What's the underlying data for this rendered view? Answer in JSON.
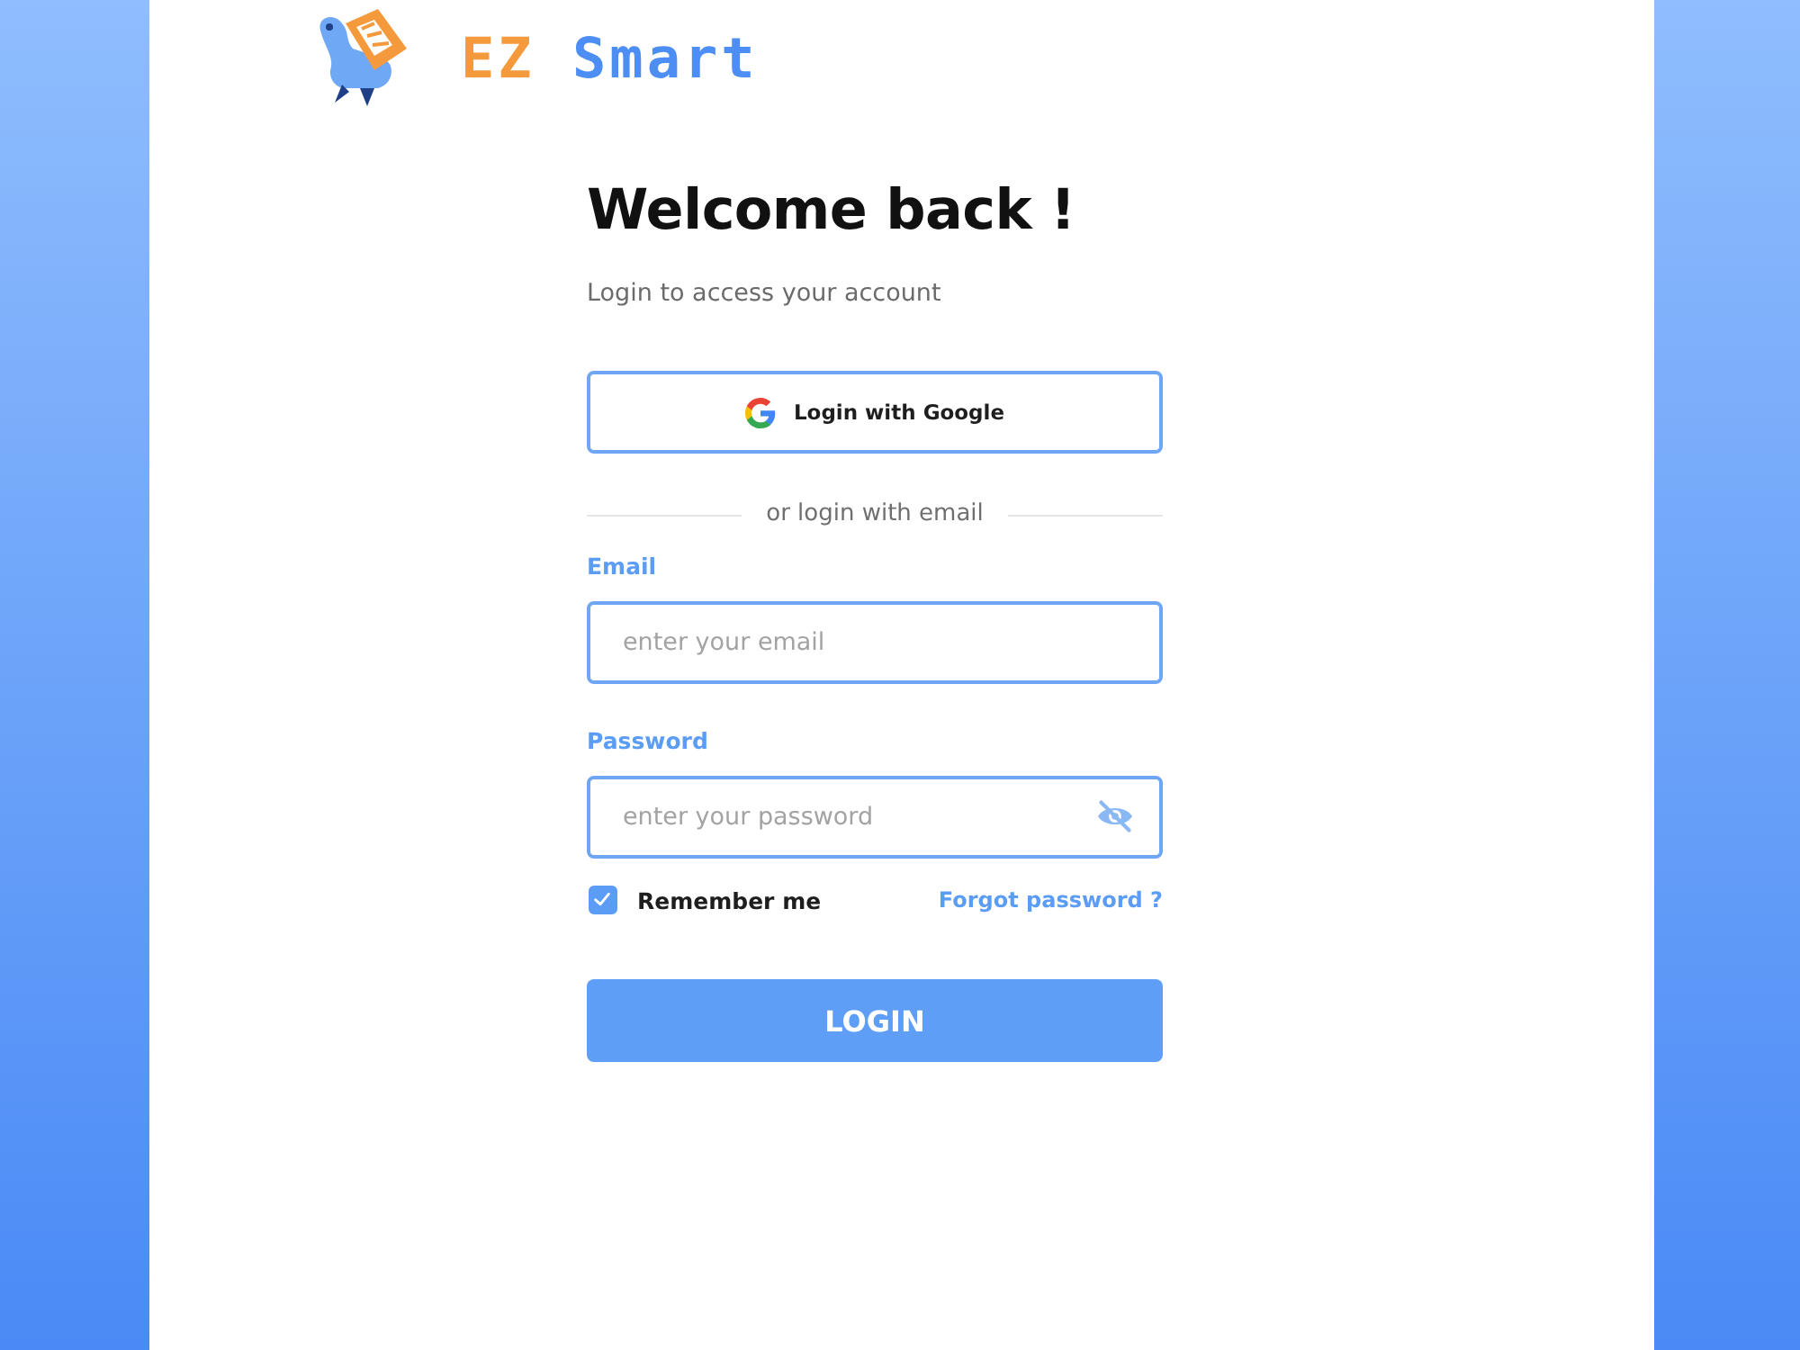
{
  "logo": {
    "brand": "EZ",
    "name": "Smart"
  },
  "heading": "Welcome back !",
  "subtitle": "Login to access your account",
  "google_button": {
    "label": "Login with Google"
  },
  "divider": "or login with email",
  "fields": [
    {
      "kind": "email",
      "label": "Email",
      "placeholder": "enter your email"
    },
    {
      "kind": "password",
      "label": "Password",
      "placeholder": "enter your password",
      "password_visible": false
    }
  ],
  "remember": {
    "label": "Remember me",
    "checked": true
  },
  "forgot_link": "Forgot password ?",
  "login_button": "LOGIN"
}
